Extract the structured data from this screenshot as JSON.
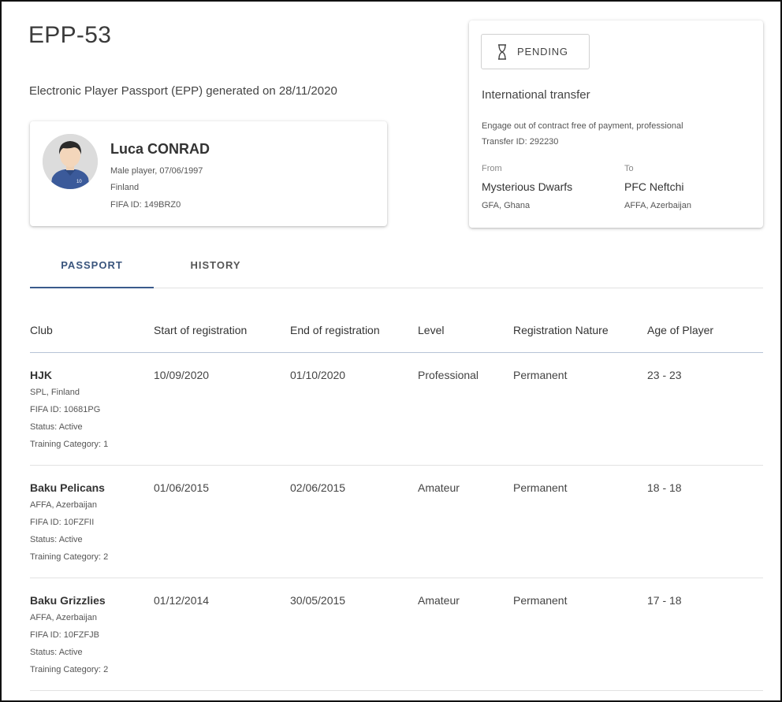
{
  "header": {
    "epp_id": "EPP-53",
    "subtitle": "Electronic Player Passport (EPP) generated on 28/11/2020"
  },
  "player": {
    "name": "Luca CONRAD",
    "gender_dob": "Male player, 07/06/1997",
    "country": "Finland",
    "fifa_id": "FIFA ID: 149BRZ0",
    "shirt_number": "10"
  },
  "transfer": {
    "status": "PENDING",
    "status_icon": "hourglass-icon",
    "type": "International transfer",
    "description": "Engage out of contract free of payment, professional",
    "transfer_id": "Transfer ID: 292230",
    "from_label": "From",
    "to_label": "To",
    "from_club": "Mysterious Dwarfs",
    "from_fed": "GFA, Ghana",
    "to_club": "PFC Neftchi",
    "to_fed": "AFFA, Azerbaijan"
  },
  "tabs": [
    "PASSPORT",
    "HISTORY"
  ],
  "table": {
    "headers": [
      "Club",
      "Start of registration",
      "End of registration",
      "Level",
      "Registration Nature",
      "Age of Player"
    ],
    "rows": [
      {
        "club": "HJK",
        "fed": "SPL, Finland",
        "fifa_id": "FIFA ID: 10681PG",
        "status": "Status: Active",
        "training": "Training Category: 1",
        "start": "10/09/2020",
        "end": "01/10/2020",
        "level": "Professional",
        "nature": "Permanent",
        "age": "23 - 23"
      },
      {
        "club": "Baku Pelicans",
        "fed": "AFFA, Azerbaijan",
        "fifa_id": "FIFA ID: 10FZFII",
        "status": "Status: Active",
        "training": "Training Category: 2",
        "start": "01/06/2015",
        "end": "02/06/2015",
        "level": "Amateur",
        "nature": "Permanent",
        "age": "18 - 18"
      },
      {
        "club": "Baku Grizzlies",
        "fed": "AFFA, Azerbaijan",
        "fifa_id": "FIFA ID: 10FZFJB",
        "status": "Status: Active",
        "training": "Training Category: 2",
        "start": "01/12/2014",
        "end": "30/05/2015",
        "level": "Amateur",
        "nature": "Permanent",
        "age": "17 - 18"
      }
    ]
  },
  "colors": {
    "accent": "#3a5a8c",
    "jersey": "#3b5a9a"
  }
}
